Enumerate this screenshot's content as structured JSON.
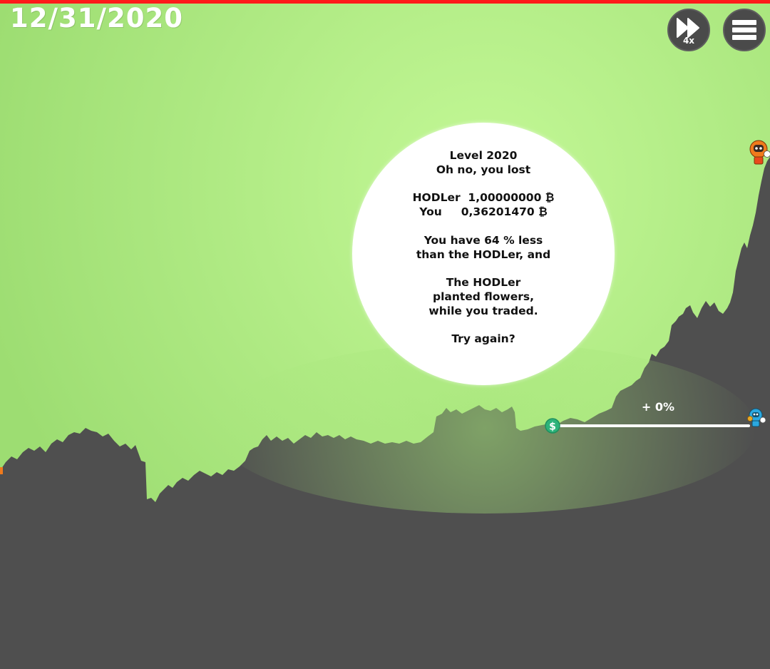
{
  "hud": {
    "date": "12/31/2020",
    "speed_label": "4x",
    "fast_forward_icon": "fast-forward-icon",
    "menu_icon": "hamburger-menu-icon"
  },
  "dialog": {
    "level": "Level 2020",
    "outcome": "Oh no, you lost",
    "hodler_row": "HODLer  1,00000000 ₿",
    "you_row": "You     0,36201470 ₿",
    "comparison_line1": "You have 64 % less",
    "comparison_line2": "than the HODLer, and",
    "message_line1": "The HODLer",
    "message_line2": "planted flowers,",
    "message_line3": "while you traded.",
    "try_again": "Try again?"
  },
  "trade": {
    "percent_label": "+ 0%",
    "coin_icon": "dollar-coin-icon",
    "player_icon": "blue-trader-character-icon",
    "hodler_icon": "orange-hodler-character-icon"
  },
  "colors": {
    "sky_light": "#c2f794",
    "sky": "#a6e57a",
    "ground": "#4f4f4f",
    "top_bar": "#ff1a1a",
    "coin": "#2db37a",
    "player": "#2aa8e0",
    "hodler": "#f07a1c"
  }
}
